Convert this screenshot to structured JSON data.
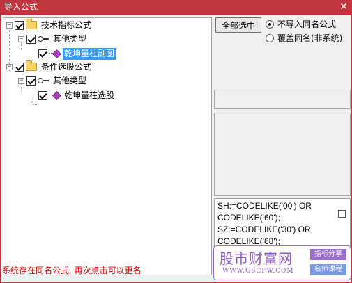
{
  "window": {
    "title": "导入公式",
    "close_glyph": "✕"
  },
  "tree": {
    "items": [
      {
        "label": "技术指标公式",
        "icon": "folder-icon",
        "expander": "−",
        "checked": true
      },
      {
        "label": "其他类型",
        "icon": "key-icon",
        "expander": "−",
        "checked": true
      },
      {
        "label": "乾坤量柱副图",
        "icon": "formula-diamond-icon",
        "checked": true,
        "selected": true
      },
      {
        "label": "条件选股公式",
        "icon": "folder-icon",
        "expander": "−",
        "checked": true
      },
      {
        "label": "其他类型",
        "icon": "key-icon",
        "expander": "−",
        "checked": true
      },
      {
        "label": "乾坤量柱选股",
        "icon": "formula-diamond-icon",
        "checked": true
      }
    ]
  },
  "options": {
    "select_all_label": "全部选中",
    "radio_no_import_label": "不导入同名公式",
    "radio_overwrite_label": "覆盖同名(非系统)",
    "selected": "no_import"
  },
  "code": {
    "lines": [
      "SH:=CODELIKE('00') OR",
      "CODELIKE('60');",
      "SZ:=CODELIKE('30') OR",
      "CODELIKE('68');"
    ]
  },
  "status": {
    "message": "系统存在同名公式, 再次点击可以更名"
  },
  "watermark": {
    "logo_text": "股市财富网",
    "url_text": "WWW.GSCFW.COM",
    "tag_1": "指标分享",
    "tag_2": "名师课程"
  },
  "colors": {
    "title_bar": "#c0343e",
    "selection": "#3399ff",
    "status_text": "#d00000",
    "watermark": "#8e5cc0"
  }
}
